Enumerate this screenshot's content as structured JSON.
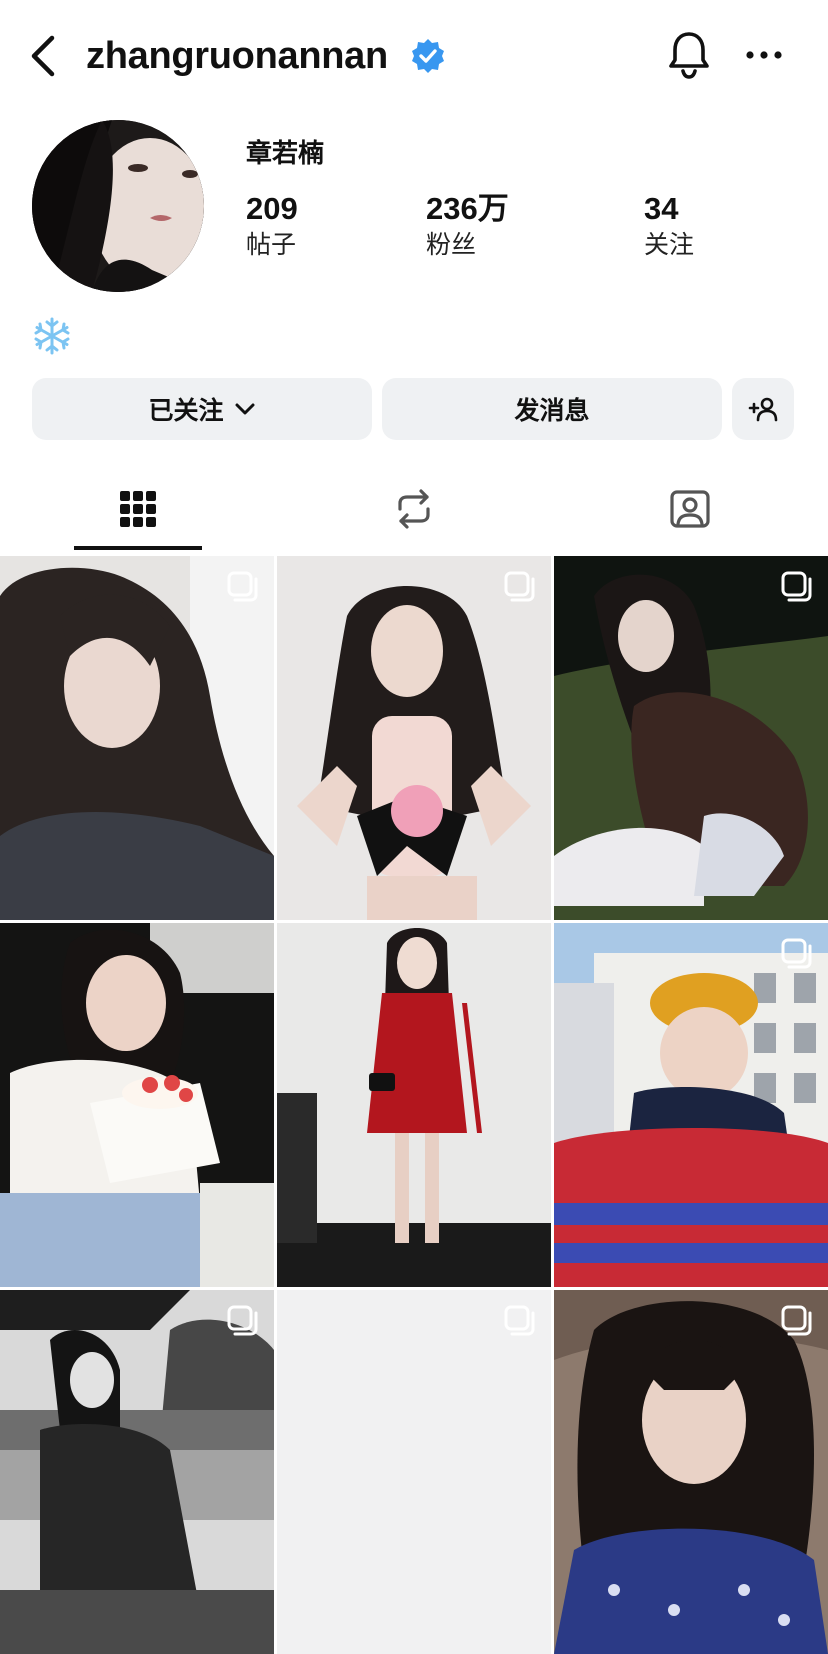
{
  "header": {
    "username": "zhangruonannan",
    "verified": true,
    "icons": [
      "back-chevron-icon",
      "verified-badge-icon",
      "bell-icon",
      "more-icon"
    ]
  },
  "profile": {
    "display_name": "章若楠",
    "stats": [
      {
        "value": "209",
        "label": "帖子"
      },
      {
        "value": "236万",
        "label": "粉丝"
      },
      {
        "value": "34",
        "label": "关注"
      }
    ],
    "bio_icon": "snowflake-icon"
  },
  "actions": {
    "following_label": "已关注",
    "message_label": "发消息",
    "add_icon": "add-person-icon"
  },
  "tabs": [
    {
      "name": "posts",
      "icon": "grid-icon",
      "active": true
    },
    {
      "name": "reposts",
      "icon": "repost-icon",
      "active": false
    },
    {
      "name": "tagged",
      "icon": "tagged-person-icon",
      "active": false
    }
  ],
  "grid": {
    "posts": [
      {
        "index": 1,
        "multi_photo": true
      },
      {
        "index": 2,
        "multi_photo": true
      },
      {
        "index": 3,
        "multi_photo": true
      },
      {
        "index": 4,
        "multi_photo": false
      },
      {
        "index": 5,
        "multi_photo": false
      },
      {
        "index": 6,
        "multi_photo": true
      },
      {
        "index": 7,
        "multi_photo": true
      },
      {
        "index": 8,
        "multi_photo": true
      },
      {
        "index": 9,
        "multi_photo": true
      }
    ]
  },
  "colors": {
    "accent_blue": "#3897f0",
    "button_bg": "#eff1f3",
    "text": "#111111"
  }
}
